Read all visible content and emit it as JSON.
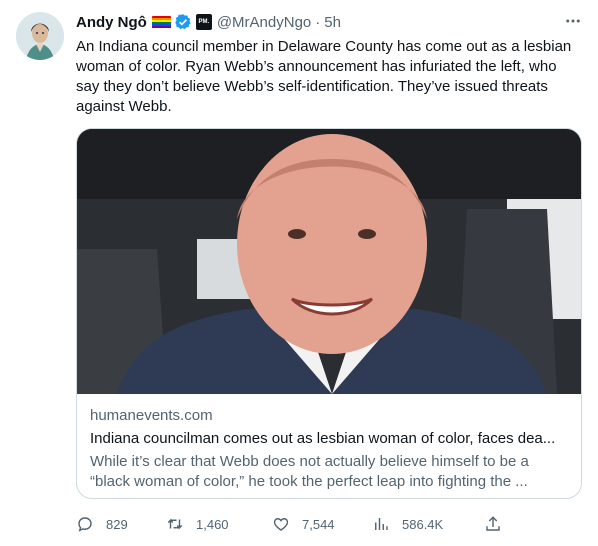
{
  "tweet": {
    "author_name": "Andy Ngô",
    "handle": "@MrAndyNgo",
    "separator": "·",
    "time": "5h",
    "affiliate_badge": "PM.",
    "text": "An Indiana council member in Delaware County has come out as a lesbian woman of color. Ryan Webb’s announcement has infuriated the left, who say they don’t believe Webb’s self-identification. They’ve issued threats against Webb."
  },
  "card": {
    "domain": "humanevents.com",
    "title": "Indiana councilman comes out as lesbian woman of color, faces dea...",
    "description": "While it’s clear that Webb does not actually believe himself to be a “black woman of color,” he took the perfect leap into fighting the ..."
  },
  "actions": {
    "replies": "829",
    "retweets": "1,460",
    "likes": "7,544",
    "views": "586.4K"
  },
  "icons": {
    "more": "more-icon",
    "verified": "verified-icon",
    "reply": "reply-icon",
    "retweet": "retweet-icon",
    "like": "like-icon",
    "views": "views-icon",
    "share": "share-icon"
  },
  "colors": {
    "accent": "#1d9bf0",
    "text": "#0f1419",
    "secondary": "#536471",
    "border": "#cfd9de"
  }
}
